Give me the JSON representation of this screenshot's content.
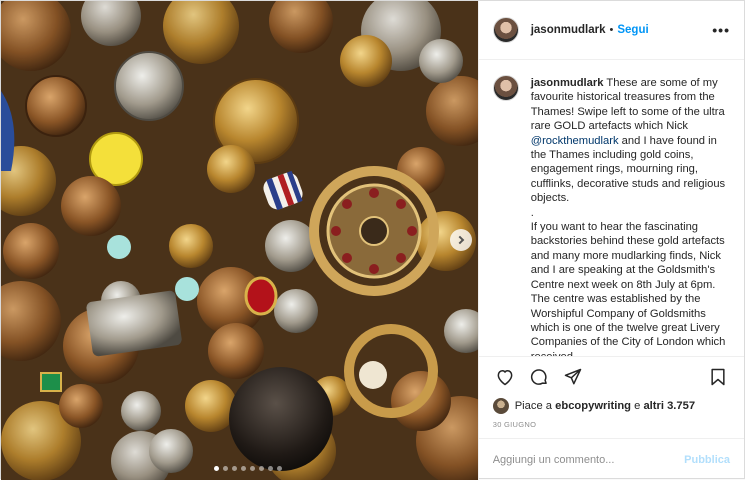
{
  "post": {
    "username": "jasonmudlark",
    "separator": "•",
    "follow_label": "Segui",
    "more_label": "•••",
    "caption": {
      "username": "jasonmudlark",
      "text_part1": " These are some of my favourite historical treasures from the Thames! Swipe left to some of the ultra rare GOLD artefacts which Nick ",
      "mention": "@rockthemudlark",
      "text_part2": " and I have found in the Thames including gold coins, engagement rings, mourning ring, cufflinks, decorative studs and religious objects.\n.\nIf you want to hear the fascinating backstories behind these gold artefacts and many more mudlarking finds, Nick and I are speaking at the Goldsmith's Centre next week on 8th July at 6pm. The centre was established by the Worshipful Company of Goldsmiths which is one of the twelve great Livery Companies of the City of London which received"
    },
    "likes": {
      "prefix": "Piace a ",
      "user": "ebcopywriting",
      "middle": " e ",
      "others": "altri 3.757"
    },
    "date": "30 GIUGNO",
    "comment_placeholder": "Aggiungi un commento...",
    "publish_label": "Pubblica",
    "carousel": {
      "slide_count": 8,
      "active_index": 0
    }
  },
  "icons": {
    "like": "heart-icon",
    "comment": "comment-icon",
    "share": "paper-plane-icon",
    "save": "bookmark-icon",
    "next": "chevron-right-icon"
  },
  "colors": {
    "follow": "#0095f6",
    "publish_disabled": "#b2dffc",
    "mention": "#00376b",
    "date": "#8e8e8e"
  }
}
